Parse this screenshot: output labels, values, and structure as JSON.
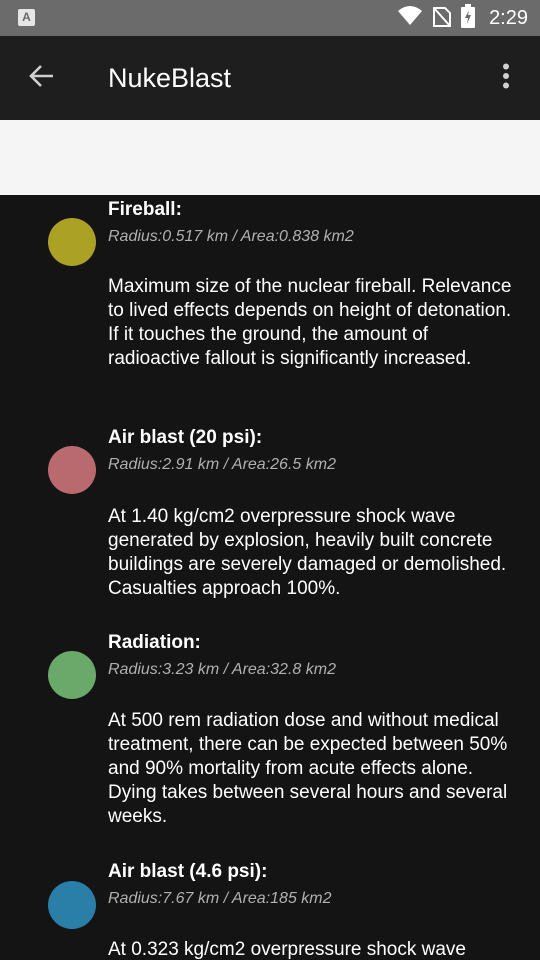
{
  "status_bar": {
    "left_icon": "A",
    "time": "2:29",
    "icons": [
      "wifi-icon",
      "no-sim-icon",
      "battery-charging-icon"
    ]
  },
  "app_bar": {
    "title": "NukeBlast",
    "back_icon": "arrow-left-icon",
    "menu_icon": "more-vert-icon"
  },
  "colors": {
    "fireball": "#aba124",
    "air_blast_20": "#b96a6f",
    "radiation": "#6aa96a",
    "air_blast_46": "#2a7fa8"
  },
  "effects": [
    {
      "title": "Fireball:",
      "stats": "Radius:0.517 km / Area:0.838 km2",
      "description": "Maximum size of the nuclear fireball. Relevance to lived effects depends on height of detonation. If it touches the ground, the amount of radioactive fallout is significantly increased."
    },
    {
      "title": "Air blast (20 psi):",
      "stats": "Radius:2.91 km / Area:26.5 km2",
      "description": "At 1.40 kg/cm2 overpressure shock wave generated by explosion, heavily built concrete buildings are severely damaged or demolished. Casualties approach 100%."
    },
    {
      "title": "Radiation:",
      "stats": "Radius:3.23 km / Area:32.8 km2",
      "description": "At 500 rem radiation dose and without medical treatment, there can be expected between 50% and 90% mortality from acute effects alone. Dying takes between several hours and several weeks."
    },
    {
      "title": "Air blast (4.6 psi):",
      "stats": "Radius:7.67 km / Area:185 km2",
      "description": "At 0.323 kg/cm2 overpressure shock wave"
    }
  ]
}
